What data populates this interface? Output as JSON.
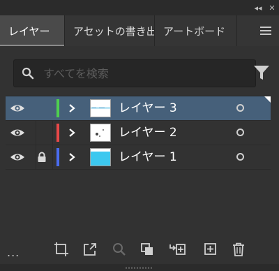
{
  "window": {
    "collapse_label": "◂◂",
    "close_label": "✕"
  },
  "tabs": [
    {
      "label": "レイヤー",
      "active": true
    },
    {
      "label": "アセットの書き出し",
      "active": false
    },
    {
      "label": "アートボード",
      "active": false
    }
  ],
  "search": {
    "placeholder": "すべてを検索",
    "value": ""
  },
  "layers": [
    {
      "name": "レイヤー 3",
      "color": "#4fcf4f",
      "selected": true,
      "locked": false,
      "visible": true
    },
    {
      "name": "レイヤー 2",
      "color": "#e84848",
      "selected": false,
      "locked": false,
      "visible": true
    },
    {
      "name": "レイヤー 1",
      "color": "#4a6cf0",
      "selected": false,
      "locked": true,
      "visible": true
    }
  ],
  "bottombar": {
    "more_label": "...",
    "icons": [
      "artboard-export-icon",
      "release-to-layers-icon",
      "locate-object-icon",
      "clipping-mask-icon",
      "new-sublayer-icon",
      "new-layer-icon",
      "delete-icon"
    ]
  }
}
